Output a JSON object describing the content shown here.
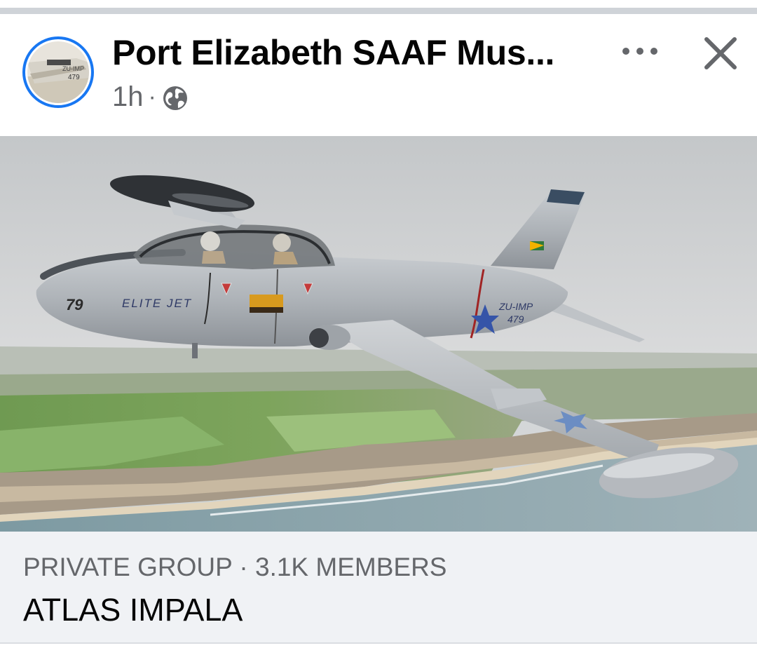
{
  "post": {
    "group_name": "Port Elizabeth SAAF Mus...",
    "time": "1h",
    "separator": "·",
    "privacy_icon": "globe-icon",
    "more_icon": "more-icon",
    "close_icon": "close-icon"
  },
  "avatar": {
    "registration": "ZU-IMP",
    "number": "479"
  },
  "photo": {
    "nose_number": "79",
    "fuselage_text": "ELITE JET",
    "registration": "ZU-IMP",
    "tail_number": "479"
  },
  "group_card": {
    "subtitle": "PRIVATE GROUP · 3.1K MEMBERS",
    "title": "ATLAS IMPALA"
  },
  "colors": {
    "accent": "#1877f2",
    "text_primary": "#050505",
    "text_secondary": "#65676b",
    "footer_bg": "#f0f2f5"
  }
}
